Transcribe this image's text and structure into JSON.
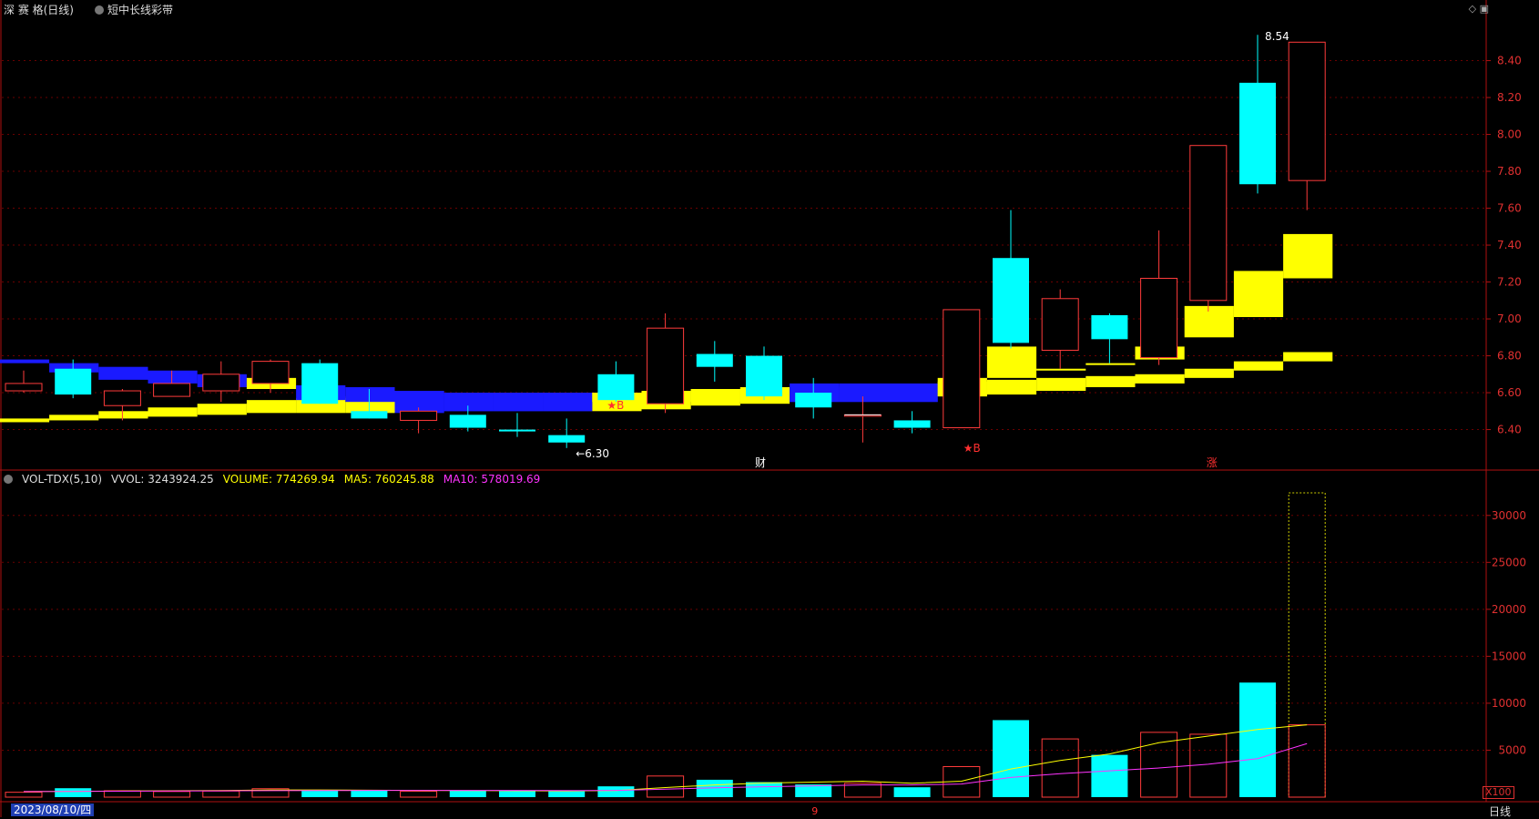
{
  "header": {
    "symbol": "深 赛 格(日线)",
    "indicator": "短中长线彩带",
    "icons": [
      "diamond-icon",
      "window-icon"
    ]
  },
  "volume_header": {
    "label": "VOL-TDX(5,10)",
    "vvol": "VVOL: 3243924.25",
    "volume": "VOLUME: 774269.94",
    "ma5": "MA5: 760245.88",
    "ma10": "MA10: 578019.69"
  },
  "footer": {
    "date": "2023/08/10/四",
    "period_tab": "日线",
    "unit_badge": "X100",
    "month_marker": "9"
  },
  "markers": {
    "cai": "财",
    "zhang": "涨",
    "low_label": "←6.30",
    "high_label": "8.54",
    "buy": "★B"
  },
  "colors": {
    "up": "#ff3b3b",
    "down": "#00ffff",
    "band_yellow": "#ffff00",
    "band_blue": "#1a1aff",
    "axis": "#b01010",
    "grid": "#6a0000",
    "text_yellow": "#ffff00",
    "text_magenta": "#ff33ff"
  },
  "chart_data": [
    {
      "type": "candlestick",
      "title": "",
      "y_ticks": [
        "8.40",
        "8.20",
        "8.00",
        "7.80",
        "7.60",
        "7.40",
        "7.20",
        "7.00",
        "6.80",
        "6.60",
        "6.40"
      ],
      "ylim": [
        6.22,
        8.62
      ],
      "grid": true,
      "candles": [
        {
          "o": 6.61,
          "h": 6.72,
          "l": 6.6,
          "c": 6.65
        },
        {
          "o": 6.73,
          "h": 6.78,
          "l": 6.57,
          "c": 6.59
        },
        {
          "o": 6.53,
          "h": 6.62,
          "l": 6.45,
          "c": 6.61
        },
        {
          "o": 6.58,
          "h": 6.72,
          "l": 6.58,
          "c": 6.65
        },
        {
          "o": 6.61,
          "h": 6.77,
          "l": 6.55,
          "c": 6.7
        },
        {
          "o": 6.65,
          "h": 6.78,
          "l": 6.6,
          "c": 6.77
        },
        {
          "o": 6.76,
          "h": 6.78,
          "l": 6.54,
          "c": 6.54
        },
        {
          "o": 6.5,
          "h": 6.62,
          "l": 6.46,
          "c": 6.46
        },
        {
          "o": 6.45,
          "h": 6.52,
          "l": 6.38,
          "c": 6.5
        },
        {
          "o": 6.48,
          "h": 6.53,
          "l": 6.39,
          "c": 6.41
        },
        {
          "o": 6.4,
          "h": 6.49,
          "l": 6.36,
          "c": 6.39
        },
        {
          "o": 6.37,
          "h": 6.46,
          "l": 6.3,
          "c": 6.33
        },
        {
          "o": 6.7,
          "h": 6.77,
          "l": 6.55,
          "c": 6.56
        },
        {
          "o": 6.54,
          "h": 7.03,
          "l": 6.49,
          "c": 6.95
        },
        {
          "o": 6.81,
          "h": 6.88,
          "l": 6.66,
          "c": 6.74
        },
        {
          "o": 6.8,
          "h": 6.85,
          "l": 6.56,
          "c": 6.58
        },
        {
          "o": 6.6,
          "h": 6.68,
          "l": 6.46,
          "c": 6.52
        },
        {
          "o": 6.48,
          "h": 6.58,
          "l": 6.33,
          "c": 6.48
        },
        {
          "o": 6.45,
          "h": 6.5,
          "l": 6.38,
          "c": 6.41
        },
        {
          "o": 6.41,
          "h": 7.05,
          "l": 6.41,
          "c": 7.05
        },
        {
          "o": 7.33,
          "h": 7.59,
          "l": 6.84,
          "c": 6.87
        },
        {
          "o": 6.83,
          "h": 7.16,
          "l": 6.73,
          "c": 7.11
        },
        {
          "o": 7.02,
          "h": 7.03,
          "l": 6.76,
          "c": 6.89
        },
        {
          "o": 6.79,
          "h": 7.48,
          "l": 6.75,
          "c": 7.22
        },
        {
          "o": 7.1,
          "h": 7.94,
          "l": 7.04,
          "c": 7.94
        },
        {
          "o": 8.28,
          "h": 8.54,
          "l": 7.68,
          "c": 7.73
        },
        {
          "o": 7.75,
          "h": 8.5,
          "l": 7.59,
          "c": 8.5
        }
      ],
      "band_bottom": [
        {
          "lo": 6.44,
          "hi": 6.46,
          "color": "yellow"
        },
        {
          "lo": 6.45,
          "hi": 6.48,
          "color": "yellow"
        },
        {
          "lo": 6.46,
          "hi": 6.5,
          "color": "yellow"
        },
        {
          "lo": 6.47,
          "hi": 6.52,
          "color": "yellow"
        },
        {
          "lo": 6.48,
          "hi": 6.54,
          "color": "yellow"
        },
        {
          "lo": 6.49,
          "hi": 6.56,
          "color": "yellow"
        },
        {
          "lo": 6.49,
          "hi": 6.57,
          "color": "yellow"
        },
        {
          "lo": 6.49,
          "hi": 6.58,
          "color": "yellow"
        },
        {
          "lo": 6.49,
          "hi": 6.59,
          "color": "blue"
        },
        {
          "lo": 6.5,
          "hi": 6.6,
          "color": "blue"
        },
        {
          "lo": 6.5,
          "hi": 6.6,
          "color": "blue"
        },
        {
          "lo": 6.5,
          "hi": 6.6,
          "color": "blue"
        },
        {
          "lo": 6.5,
          "hi": 6.6,
          "color": "yellow"
        },
        {
          "lo": 6.51,
          "hi": 6.6,
          "color": "yellow"
        },
        {
          "lo": 6.53,
          "hi": 6.62,
          "color": "yellow"
        },
        {
          "lo": 6.54,
          "hi": 6.63,
          "color": "yellow"
        },
        {
          "lo": 6.55,
          "hi": 6.63,
          "color": "blue"
        },
        {
          "lo": 6.55,
          "hi": 6.64,
          "color": "blue"
        },
        {
          "lo": 6.55,
          "hi": 6.64,
          "color": "blue"
        },
        {
          "lo": 6.58,
          "hi": 6.68,
          "color": "yellow"
        },
        {
          "lo": 6.59,
          "hi": 6.67,
          "color": "yellow"
        },
        {
          "lo": 6.61,
          "hi": 6.68,
          "color": "yellow"
        },
        {
          "lo": 6.63,
          "hi": 6.69,
          "color": "yellow"
        },
        {
          "lo": 6.65,
          "hi": 6.7,
          "color": "yellow"
        },
        {
          "lo": 6.68,
          "hi": 6.73,
          "color": "yellow"
        },
        {
          "lo": 6.72,
          "hi": 6.77,
          "color": "yellow"
        },
        {
          "lo": 6.77,
          "hi": 6.82,
          "color": "yellow"
        }
      ],
      "band_top": [
        {
          "lo": 6.76,
          "hi": 6.78,
          "color": "blue"
        },
        {
          "lo": 6.71,
          "hi": 6.76,
          "color": "blue"
        },
        {
          "lo": 6.67,
          "hi": 6.74,
          "color": "blue"
        },
        {
          "lo": 6.65,
          "hi": 6.72,
          "color": "blue"
        },
        {
          "lo": 6.63,
          "hi": 6.7,
          "color": "blue"
        },
        {
          "lo": 6.62,
          "hi": 6.68,
          "color": "yellow"
        },
        {
          "lo": 6.56,
          "hi": 6.64,
          "color": "blue"
        },
        {
          "lo": 6.55,
          "hi": 6.63,
          "color": "blue"
        },
        {
          "lo": 6.5,
          "hi": 6.61,
          "color": "blue"
        },
        {
          "lo": 6.5,
          "hi": 6.6,
          "color": "blue"
        },
        {
          "lo": 6.5,
          "hi": 6.6,
          "color": "blue"
        },
        {
          "lo": 6.5,
          "hi": 6.6,
          "color": "blue"
        },
        {
          "lo": 6.55,
          "hi": 6.6,
          "color": "yellow"
        },
        {
          "lo": 6.55,
          "hi": 6.61,
          "color": "yellow"
        },
        {
          "lo": 6.55,
          "hi": 6.62,
          "color": "yellow"
        },
        {
          "lo": 6.55,
          "hi": 6.63,
          "color": "yellow"
        },
        {
          "lo": 6.55,
          "hi": 6.65,
          "color": "blue"
        },
        {
          "lo": 6.55,
          "hi": 6.65,
          "color": "blue"
        },
        {
          "lo": 6.55,
          "hi": 6.65,
          "color": "blue"
        },
        {
          "lo": 6.58,
          "hi": 6.66,
          "color": "yellow"
        },
        {
          "lo": 6.68,
          "hi": 6.85,
          "color": "yellow"
        },
        {
          "lo": 6.72,
          "hi": 6.73,
          "color": "yellow"
        },
        {
          "lo": 6.75,
          "hi": 6.76,
          "color": "yellow"
        },
        {
          "lo": 6.78,
          "hi": 6.85,
          "color": "yellow"
        },
        {
          "lo": 6.9,
          "hi": 7.07,
          "color": "yellow"
        },
        {
          "lo": 7.01,
          "hi": 7.26,
          "color": "yellow"
        },
        {
          "lo": 7.22,
          "hi": 7.46,
          "color": "yellow"
        }
      ]
    },
    {
      "type": "bar",
      "title": "VOL-TDX(5,10)",
      "y_ticks": [
        "30000",
        "25000",
        "20000",
        "15000",
        "10000",
        "5000"
      ],
      "ylim": [
        0,
        32500
      ],
      "unit": "X100",
      "volumes": [
        520,
        950,
        680,
        600,
        650,
        900,
        780,
        700,
        620,
        690,
        640,
        620,
        1150,
        2250,
        1850,
        1600,
        1350,
        1480,
        1050,
        3250,
        8200,
        6200,
        4500,
        6900,
        6700,
        12200,
        32400
      ],
      "ma5": [
        600,
        620,
        650,
        680,
        700,
        760,
        760,
        740,
        720,
        700,
        680,
        650,
        700,
        1020,
        1300,
        1500,
        1600,
        1700,
        1480,
        1700,
        3000,
        3900,
        4600,
        5800,
        6500,
        7200,
        7700
      ],
      "ma10": [
        600,
        610,
        630,
        650,
        670,
        690,
        700,
        710,
        720,
        720,
        710,
        700,
        720,
        850,
        1000,
        1100,
        1200,
        1300,
        1300,
        1400,
        2100,
        2500,
        2800,
        3100,
        3500,
        4100,
        5700
      ]
    }
  ]
}
